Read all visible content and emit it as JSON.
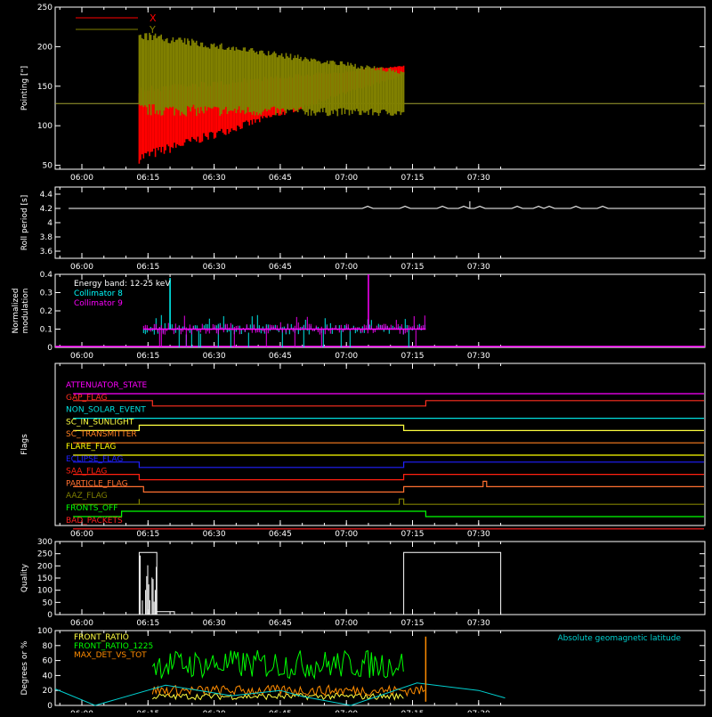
{
  "chart_data": [
    {
      "type": "line",
      "ylabel": "Pointing [\"]",
      "ylim": [
        45,
        250
      ],
      "yticks": [
        50,
        100,
        150,
        200,
        250
      ],
      "x_tick_labels": [
        "06:00",
        "06:15",
        "06:30",
        "06:45",
        "07:00",
        "07:15",
        "07:30"
      ],
      "legend_position": "top-left",
      "series": [
        {
          "name": "X",
          "color": "#ff0000",
          "envelope": {
            "start": "06:13",
            "end": "07:13",
            "lower_start": 52,
            "lower_end": 163,
            "upper_start": 150,
            "upper_end": 176
          }
        },
        {
          "name": "Y",
          "color": "#808000",
          "envelope": {
            "start": "06:13",
            "end": "07:13",
            "lower_start": 112,
            "lower_end": 112,
            "upper_start": 220,
            "upper_end": 170
          }
        }
      ],
      "reference_line": {
        "value": 128,
        "color": "#a0a030"
      }
    },
    {
      "type": "line",
      "ylabel": "Roll period [s]",
      "ylim": [
        3.5,
        4.5
      ],
      "yticks": [
        3.6,
        3.8,
        4.0,
        4.2,
        4.4
      ],
      "x_tick_labels": [
        "06:00",
        "06:15",
        "06:30",
        "06:45",
        "07:00",
        "07:15",
        "07:30"
      ],
      "baseline": 4.2,
      "spikes": [
        {
          "t": "07:28",
          "value": 4.3
        }
      ]
    },
    {
      "type": "line",
      "ylabel": "Normalized modulation",
      "ylim": [
        0,
        0.4
      ],
      "yticks": [
        0.0,
        0.1,
        0.2,
        0.3,
        0.4
      ],
      "x_tick_labels": [
        "06:00",
        "06:15",
        "06:30",
        "06:45",
        "07:00",
        "07:15",
        "07:30"
      ],
      "annotation": "Energy band: 12-25 keV",
      "series": [
        {
          "name": "Collimator 8",
          "color": "#00ffff"
        },
        {
          "name": "Collimator 9",
          "color": "#ff00ff"
        }
      ],
      "active_window": [
        "06:14",
        "07:18"
      ],
      "baseline": 0.1,
      "peaks": [
        {
          "t": "06:20",
          "value": 0.38,
          "series": "Collimator 8"
        },
        {
          "t": "07:05",
          "value": 0.4,
          "series": "Collimator 9"
        }
      ]
    },
    {
      "type": "line",
      "ylabel": "Flags",
      "x_tick_labels": [
        "06:00",
        "06:15",
        "06:30",
        "06:45",
        "07:00",
        "07:15",
        "07:30"
      ],
      "flags": [
        {
          "name": "ATTENUATOR_STATE",
          "color": "#ff00ff",
          "transitions": []
        },
        {
          "name": "GAP_FLAG",
          "color": "#ff3020",
          "transitions": [
            {
              "t": "06:16",
              "to": 0
            },
            {
              "t": "07:18",
              "to": 1
            }
          ]
        },
        {
          "name": "NON_SOLAR_EVENT",
          "color": "#00e0e0",
          "transitions": []
        },
        {
          "name": "SC_IN_SUNLIGHT",
          "color": "#ffff40",
          "transitions": [
            {
              "t": "06:13",
              "to": 1
            },
            {
              "t": "07:13",
              "to": 0
            }
          ]
        },
        {
          "name": "SC_TRANSMITTER",
          "color": "#ff8020",
          "transitions": []
        },
        {
          "name": "FLARE_FLAG",
          "color": "#ffff00",
          "transitions": []
        },
        {
          "name": "ECLIPSE_FLAG",
          "color": "#2020ff",
          "transitions": [
            {
              "t": "06:13",
              "to": 0
            },
            {
              "t": "07:13",
              "to": 1
            }
          ]
        },
        {
          "name": "SAA_FLAG",
          "color": "#ff2010",
          "transitions": [
            {
              "t": "06:13",
              "to": 0
            },
            {
              "t": "07:13",
              "to": 1
            }
          ]
        },
        {
          "name": "PARTICLE_FLAG",
          "color": "#ff7030",
          "transitions": [
            {
              "t": "06:14",
              "to": 0
            },
            {
              "t": "07:13",
              "to": 1
            },
            {
              "t": "07:31",
              "to": 2
            }
          ]
        },
        {
          "name": "AAZ_FLAG",
          "color": "#808000",
          "transitions": [
            {
              "t": "06:13",
              "to": 1
            },
            {
              "t": "06:13",
              "to": 0
            },
            {
              "t": "07:12",
              "to": 1
            },
            {
              "t": "07:13",
              "to": 0
            }
          ]
        },
        {
          "name": "FRONTS_OFF",
          "color": "#00ff00",
          "transitions": [
            {
              "t": "06:09",
              "to": 1
            },
            {
              "t": "07:18",
              "to": 0
            }
          ]
        },
        {
          "name": "BAD_PACKETS",
          "color": "#ff2020",
          "transitions": []
        }
      ]
    },
    {
      "type": "line",
      "ylabel": "Quality",
      "ylim": [
        0,
        300
      ],
      "yticks": [
        0,
        50,
        100,
        150,
        200,
        250,
        300
      ],
      "x_tick_labels": [
        "06:00",
        "06:15",
        "06:30",
        "06:45",
        "07:00",
        "07:15",
        "07:30"
      ],
      "segments": [
        {
          "start": "06:13",
          "end": "06:17",
          "value": 255
        },
        {
          "start": "06:17",
          "end": "06:21",
          "value": 12
        },
        {
          "start": "07:13",
          "end": "07:35",
          "value": 255
        }
      ]
    },
    {
      "type": "line",
      "ylabel": "Degrees or %",
      "ylim": [
        0,
        100
      ],
      "yticks": [
        0,
        20,
        40,
        60,
        80,
        100
      ],
      "x_tick_labels": [
        "06:00",
        "06:15",
        "06:30",
        "06:45",
        "07:00",
        "07:15",
        "07:30"
      ],
      "series": [
        {
          "name": "FRONT_RATIO",
          "color": "#ffff40",
          "level": 12,
          "window": [
            "06:16",
            "07:13"
          ]
        },
        {
          "name": "FRONT_RATIO_1225",
          "color": "#00ff00",
          "level": 55,
          "window": [
            "06:16",
            "07:13"
          ]
        },
        {
          "name": "MAX_DET_VS_TOT",
          "color": "#ff8c00",
          "level": 20,
          "window": [
            "06:16",
            "07:18"
          ]
        },
        {
          "name": "Absolute geomagnetic latitude",
          "color": "#00d0d0",
          "points": [
            [
              "05:50",
              22
            ],
            [
              "06:03",
              0
            ],
            [
              "06:19",
              27
            ],
            [
              "06:34",
              13
            ],
            [
              "06:45",
              20
            ],
            [
              "06:50",
              12
            ],
            [
              "07:01",
              0
            ],
            [
              "07:16",
              30
            ],
            [
              "07:30",
              20
            ],
            [
              "07:36",
              10
            ]
          ]
        }
      ]
    }
  ]
}
